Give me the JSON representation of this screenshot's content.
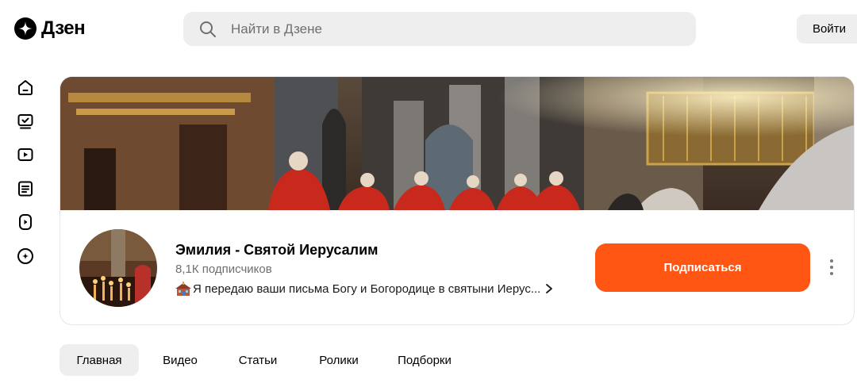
{
  "header": {
    "logo_text": "Дзен",
    "logo_icon": "dzen-star-icon",
    "search_placeholder": "Найти в Дзене",
    "search_value": "",
    "login_label": "Войти"
  },
  "sidebar": {
    "items": [
      {
        "icon": "home-icon"
      },
      {
        "icon": "subscriptions-icon"
      },
      {
        "icon": "video-icon"
      },
      {
        "icon": "articles-icon"
      },
      {
        "icon": "shorts-icon"
      },
      {
        "icon": "dzen-logo-icon"
      }
    ]
  },
  "channel": {
    "name": "Эмилия - Святой Иерусалим",
    "subscribers": "8,1К подписчиков",
    "description": "Я передаю ваши письма Богу и Богородице в святыни Иерус...",
    "description_icon": "church-emoji-icon",
    "subscribe_label": "Подписаться"
  },
  "tabs": [
    {
      "label": "Главная",
      "active": true
    },
    {
      "label": "Видео",
      "active": false
    },
    {
      "label": "Статьи",
      "active": false
    },
    {
      "label": "Ролики",
      "active": false
    },
    {
      "label": "Подборки",
      "active": false
    }
  ],
  "colors": {
    "accent": "#ff5614",
    "surface": "#eeeeef",
    "muted_text": "#6f6f73"
  }
}
